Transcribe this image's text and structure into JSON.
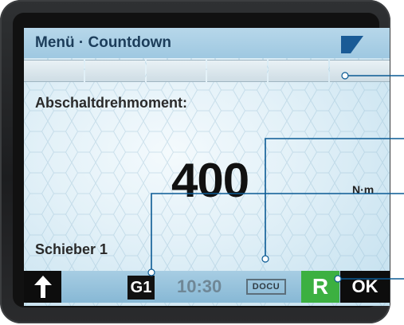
{
  "header": {
    "title": "Menü · Countdown"
  },
  "tabs": [
    {},
    {},
    {},
    {},
    {},
    {}
  ],
  "main": {
    "parameter_label": "Abschaltdrehmoment:",
    "value": "400",
    "unit": "N·m",
    "actuator_label": "Schieber 1"
  },
  "bottombar": {
    "group_badge": "G1",
    "time": "10:30",
    "docu_label": "DOCU",
    "right_button": "R",
    "ok_button": "OK"
  },
  "icons": [
    "up-arrow-icon",
    "corner-flag-icon"
  ],
  "colors": {
    "title_bar": "#9ec8e1",
    "title_text": "#1c3d5a",
    "callout_line": "#0a5a94",
    "r_button": "#3cb041",
    "black_buttons": "#0d0d0d"
  }
}
